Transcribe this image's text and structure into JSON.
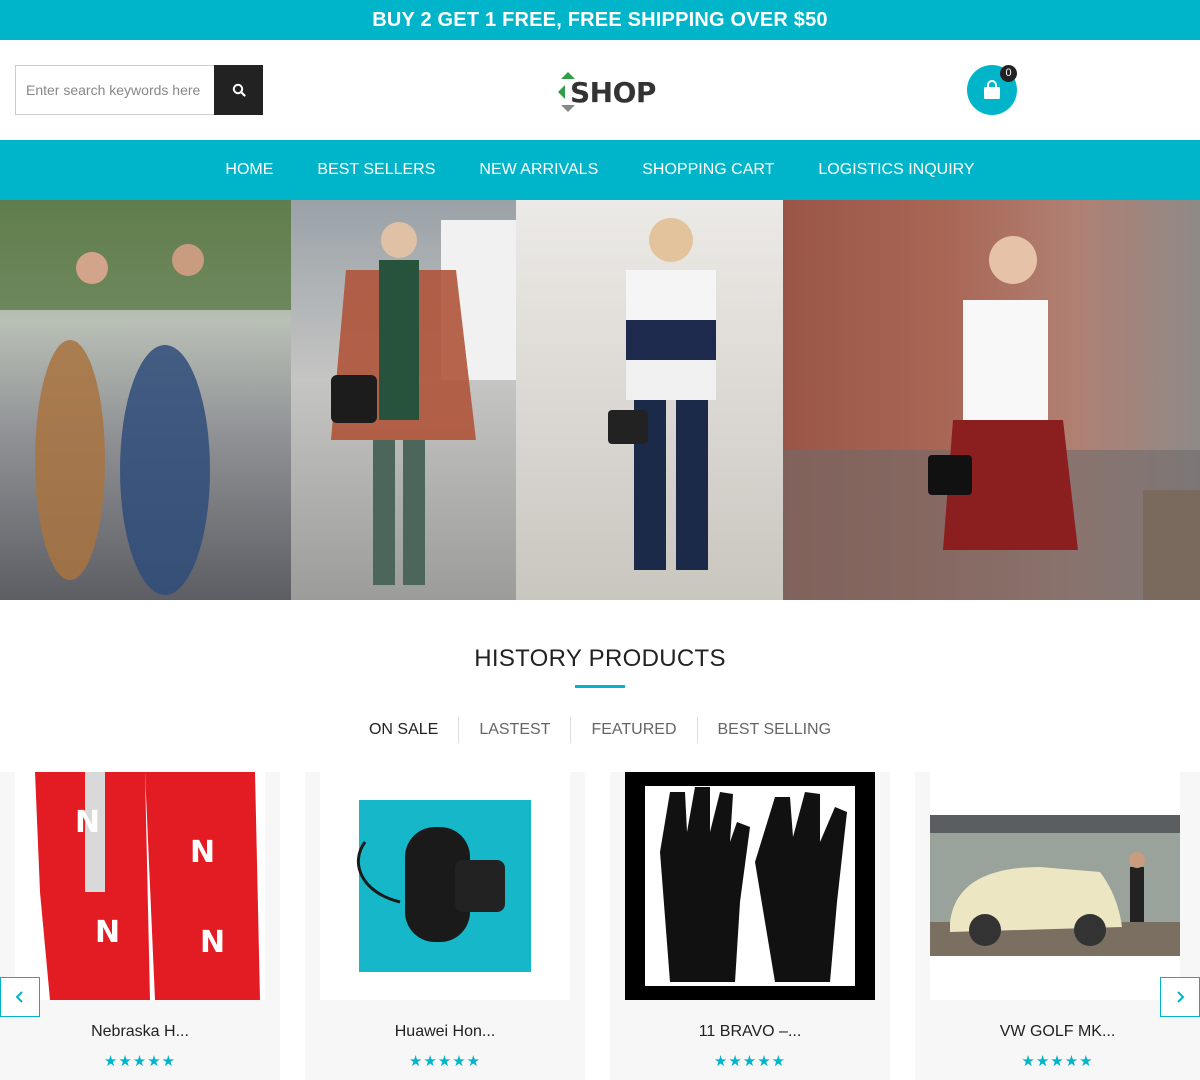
{
  "promo": {
    "text": "BUY 2 GET 1 FREE, FREE SHIPPING OVER $50"
  },
  "search": {
    "placeholder": "Enter search keywords here"
  },
  "logo": {
    "text": "SHOP"
  },
  "cart": {
    "count": "0"
  },
  "nav": {
    "items": [
      {
        "label": "HOME"
      },
      {
        "label": "BEST SELLERS"
      },
      {
        "label": "NEW ARRIVALS"
      },
      {
        "label": "SHOPPING CART"
      },
      {
        "label": "LOGISTICS INQUIRY"
      }
    ]
  },
  "section": {
    "title": "HISTORY PRODUCTS"
  },
  "tabs": [
    {
      "label": "ON SALE"
    },
    {
      "label": "LASTEST"
    },
    {
      "label": "FEATURED"
    },
    {
      "label": "BEST SELLING"
    }
  ],
  "products": [
    {
      "name": "Nebraska H...",
      "rating": "5"
    },
    {
      "name": "Huawei Hon...",
      "rating": "5"
    },
    {
      "name": "11 BRAVO –...",
      "rating": "5"
    },
    {
      "name": "VW GOLF MK...",
      "rating": "5"
    }
  ],
  "stars_text": "★★★★★",
  "colors": {
    "accent": "#00b5c9",
    "dark": "#222222"
  }
}
